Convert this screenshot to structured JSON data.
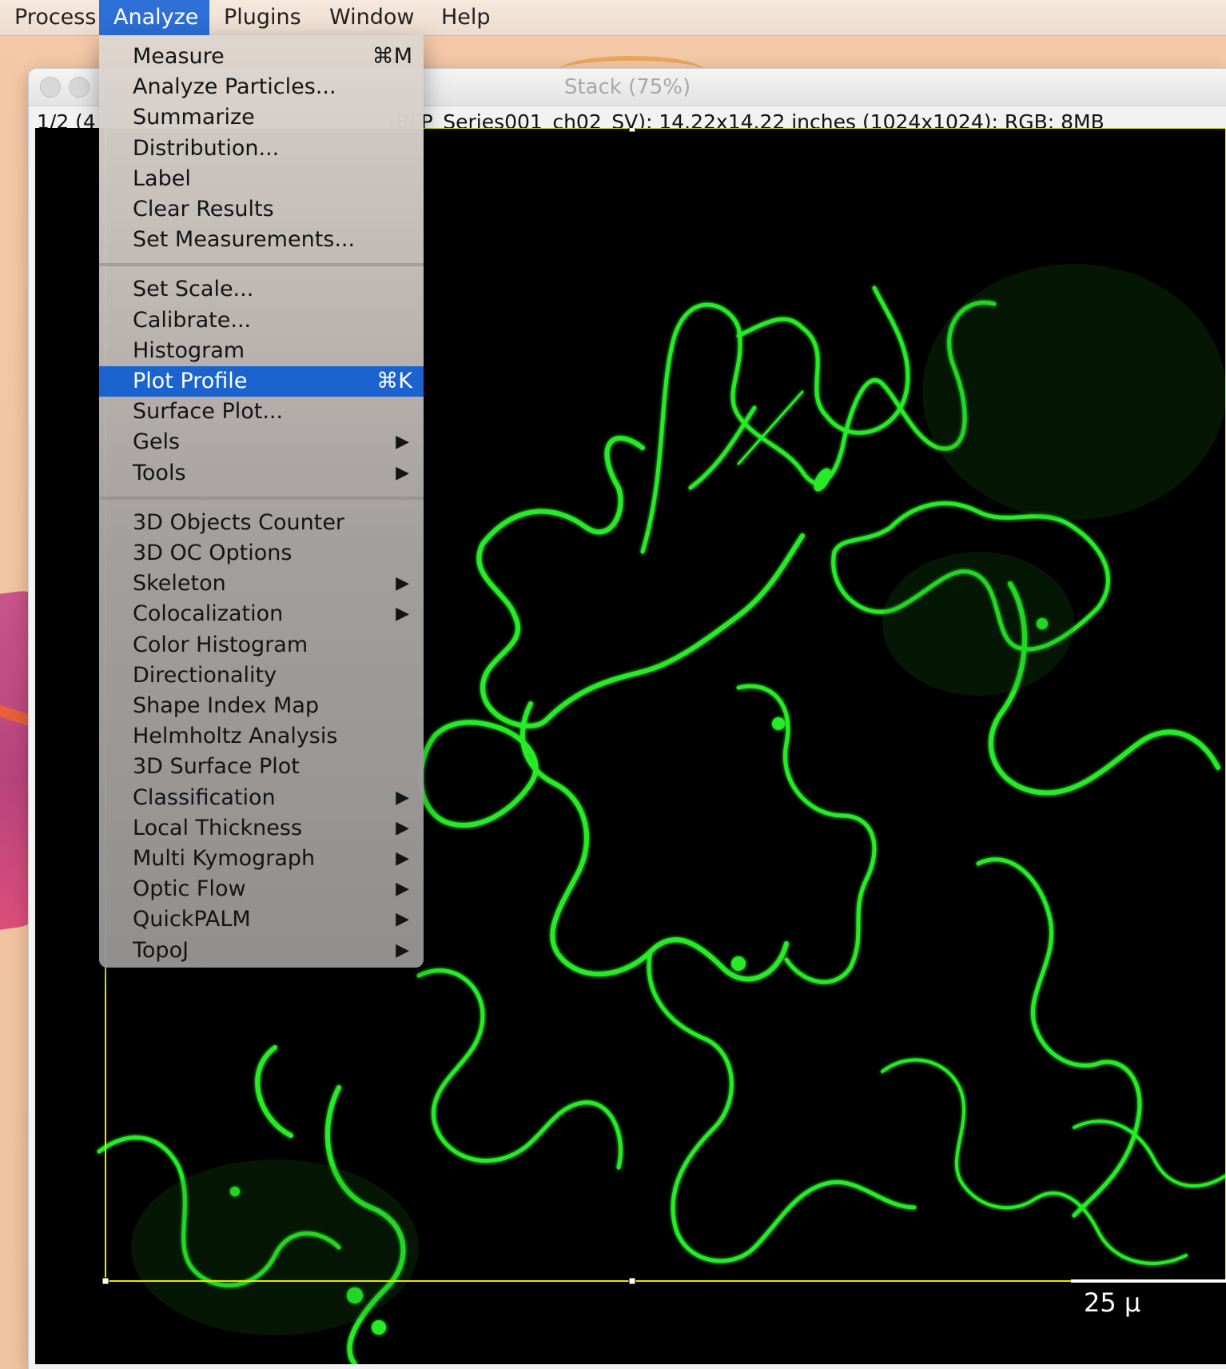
{
  "menubar": {
    "items": [
      "Process",
      "Analyze",
      "Plugins",
      "Window",
      "Help"
    ],
    "active": "Analyze"
  },
  "window": {
    "title": "Stack (75%)",
    "info_left": "1/2 (4",
    "info_right": "-BFP_Series001_ch02_SV); 14.22x14.22 inches (1024x1024); RGB; 8MB",
    "scale_bar": "25 µ"
  },
  "analyze_menu": {
    "groups": [
      [
        {
          "label": "Measure",
          "shortcut": "⌘M"
        },
        {
          "label": "Analyze Particles..."
        },
        {
          "label": "Summarize"
        },
        {
          "label": "Distribution..."
        },
        {
          "label": "Label"
        },
        {
          "label": "Clear Results"
        },
        {
          "label": "Set Measurements..."
        }
      ],
      [
        {
          "label": "Set Scale..."
        },
        {
          "label": "Calibrate..."
        },
        {
          "label": "Histogram"
        },
        {
          "label": "Plot Profile",
          "shortcut": "⌘K",
          "highlighted": true
        },
        {
          "label": "Surface Plot..."
        },
        {
          "label": "Gels",
          "submenu": true
        },
        {
          "label": "Tools",
          "submenu": true
        }
      ],
      [
        {
          "label": "3D Objects Counter"
        },
        {
          "label": "3D OC Options"
        },
        {
          "label": "Skeleton",
          "submenu": true
        },
        {
          "label": "Colocalization",
          "submenu": true
        },
        {
          "label": "Color Histogram"
        },
        {
          "label": "Directionality"
        },
        {
          "label": "Shape Index Map"
        },
        {
          "label": "Helmholtz Analysis"
        },
        {
          "label": "3D Surface Plot"
        },
        {
          "label": "Classification",
          "submenu": true
        },
        {
          "label": "Local Thickness",
          "submenu": true
        },
        {
          "label": "Multi Kymograph",
          "submenu": true
        },
        {
          "label": "Optic Flow",
          "submenu": true
        },
        {
          "label": "QuickPALM",
          "submenu": true
        },
        {
          "label": "TopoJ",
          "submenu": true
        }
      ]
    ],
    "submenu_arrow": "▶"
  },
  "colors": {
    "highlight": "#1b63cf",
    "active_menu": "#2d6fd6",
    "fluorescence": "#2bff2b",
    "selection": "#e8e800"
  },
  "icons": [
    "close-button-icon",
    "minimize-button-icon",
    "submenu-arrow-icon"
  ]
}
